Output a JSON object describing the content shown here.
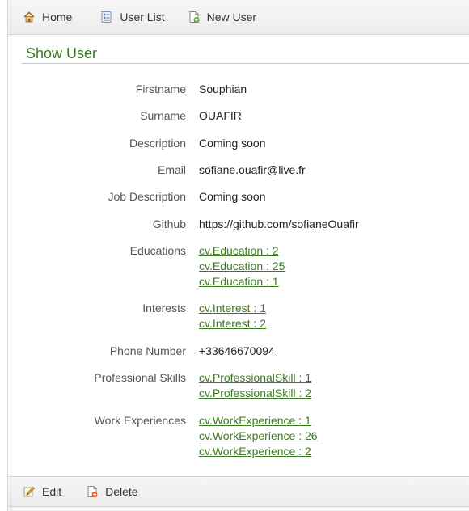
{
  "nav": {
    "home": "Home",
    "user_list": "User List",
    "new_user": "New User"
  },
  "page_title": "Show User",
  "fields": {
    "firstname": {
      "label": "Firstname",
      "value": "Souphian"
    },
    "surname": {
      "label": "Surname",
      "value": "OUAFIR"
    },
    "description": {
      "label": "Description",
      "value": "Coming soon"
    },
    "email": {
      "label": "Email",
      "value": "sofiane.ouafir@live.fr"
    },
    "job_description": {
      "label": "Job Description",
      "value": "Coming soon"
    },
    "github": {
      "label": "Github",
      "value": "https://github.com/sofianeOuafir"
    },
    "educations": {
      "label": "Educations",
      "links": [
        "cv.Education : 2",
        "cv.Education : 25",
        "cv.Education : 1"
      ]
    },
    "interests": {
      "label": "Interests",
      "links": [
        "cv.Interest : 1",
        "cv.Interest : 2"
      ]
    },
    "phone_number": {
      "label": "Phone Number",
      "value": "+33646670094"
    },
    "professional_skills": {
      "label": "Professional Skills",
      "links": [
        "cv.ProfessionalSkill : 1",
        "cv.ProfessionalSkill : 2"
      ]
    },
    "work_experiences": {
      "label": "Work Experiences",
      "links": [
        "cv.WorkExperience : 1",
        "cv.WorkExperience : 26",
        "cv.WorkExperience : 2"
      ]
    }
  },
  "actions": {
    "edit": "Edit",
    "delete": "Delete"
  },
  "colors": {
    "accent_green": "#3c7a22"
  },
  "icons": {
    "home": "home-icon",
    "user_list": "user-list-icon",
    "new_user": "new-user-icon",
    "edit": "edit-icon",
    "delete": "delete-icon"
  }
}
